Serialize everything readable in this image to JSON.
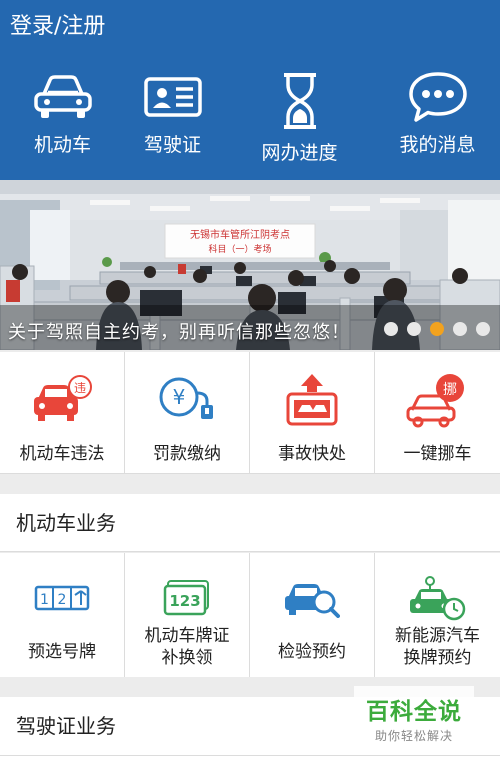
{
  "header": {
    "login_label": "登录/注册",
    "background": "#2468b0",
    "nav": [
      {
        "label": "机动车",
        "icon": "car-icon"
      },
      {
        "label": "驾驶证",
        "icon": "id-card-icon"
      },
      {
        "label": "网办进度",
        "icon": "hourglass-icon"
      },
      {
        "label": "我的消息",
        "icon": "chat-bubble-icon"
      }
    ]
  },
  "banner": {
    "caption": "关于驾照自主约考，别再听信那些忽悠！",
    "sign_line1": "无锡市车管所江阴考点",
    "sign_line2": "科目（一）考场",
    "dot_count": 5,
    "active_dot_index": 2,
    "active_dot_color": "#f2a21e"
  },
  "quick_actions": [
    {
      "label": "机动车违法",
      "icon": "car-violation-icon"
    },
    {
      "label": "罚款缴纳",
      "icon": "yen-coin-icon"
    },
    {
      "label": "事故快处",
      "icon": "accident-photo-icon"
    },
    {
      "label": "一键挪车",
      "icon": "move-car-icon"
    }
  ],
  "vehicle_section": {
    "title": "机动车业务",
    "items": [
      {
        "line1": "预选号牌",
        "line2": "",
        "icon": "plate-selection-icon"
      },
      {
        "line1": "机动车牌证",
        "line2": "补换领",
        "icon": "plate-123-icon"
      },
      {
        "line1": "检验预约",
        "line2": "",
        "icon": "car-inspection-icon"
      },
      {
        "line1": "新能源汽车",
        "line2": "换牌预约",
        "icon": "ev-car-clock-icon"
      }
    ]
  },
  "license_section": {
    "title": "驾驶证业务"
  },
  "watermark": {
    "title": "百科全说",
    "subtitle": "助你轻松解决",
    "color": "#3cab3c"
  }
}
